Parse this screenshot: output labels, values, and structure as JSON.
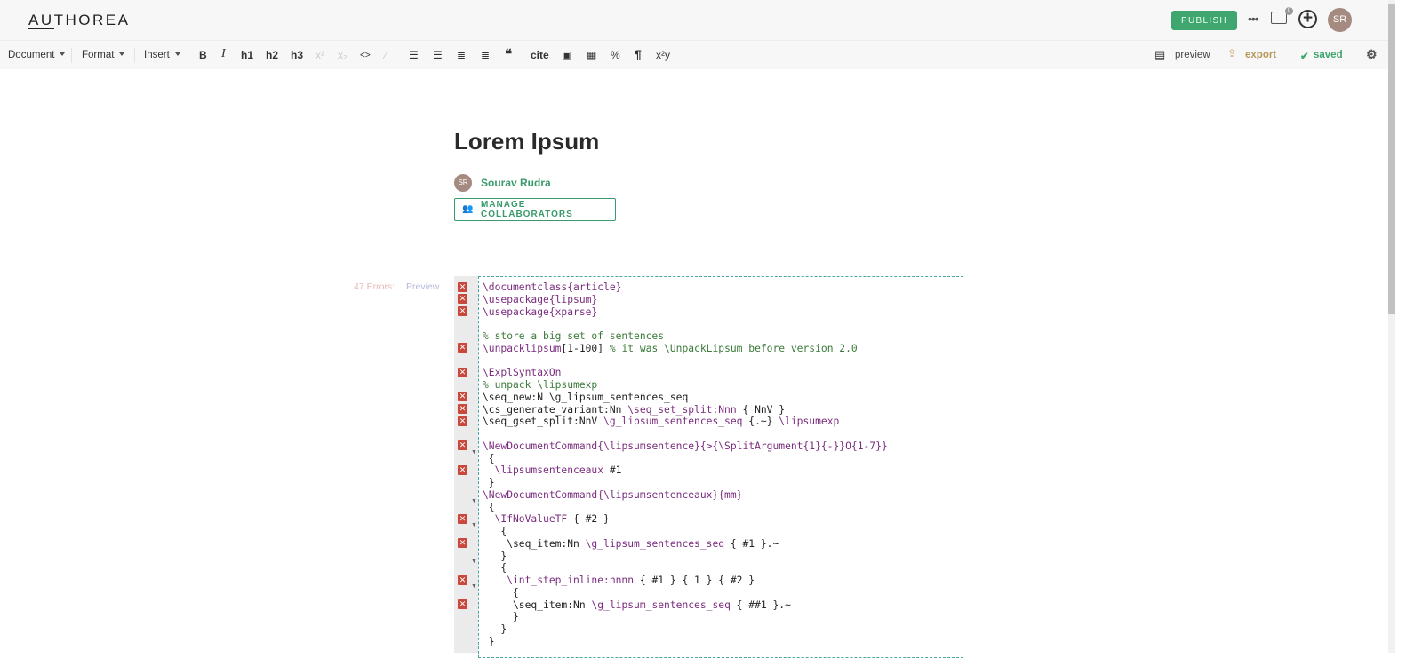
{
  "header": {
    "logo": "AUTHOREA",
    "publish": "PUBLISH",
    "more": "•••",
    "comments_badge": "0",
    "avatar": "SR"
  },
  "toolbar": {
    "document": "Document",
    "format": "Format",
    "insert": "Insert",
    "bold": "B",
    "italic": "I",
    "h1": "h1",
    "h2": "h2",
    "h3": "h3",
    "sup": "x²",
    "sub": "x₂",
    "code": "<>",
    "cite": "cite",
    "quote": "❝",
    "pilcrow": "¶",
    "xy": "x²y",
    "preview": "preview",
    "export": "export",
    "saved": "saved"
  },
  "doc": {
    "title": "Lorem Ipsum",
    "author": "Sourav Rudra",
    "author_initials": "SR",
    "collaborators": "MANAGE COLLABORATORS"
  },
  "editor": {
    "errors": "47 Errors:",
    "preview": "Preview",
    "lines": [
      {
        "e": 1,
        "t": [
          [
            "\\documentclass",
            "cmd"
          ],
          [
            "{article}",
            "arg"
          ]
        ]
      },
      {
        "e": 1,
        "t": [
          [
            "\\usepackage",
            "cmd"
          ],
          [
            "{lipsum}",
            "arg"
          ]
        ]
      },
      {
        "e": 1,
        "t": [
          [
            "\\usepackage",
            "cmd"
          ],
          [
            "{xparse}",
            "arg"
          ]
        ]
      },
      {
        "t": []
      },
      {
        "t": [
          [
            "% store a big set of sentences",
            "cmt"
          ]
        ]
      },
      {
        "e": 1,
        "t": [
          [
            "\\unpacklipsum",
            "cmd"
          ],
          [
            "[1-100] ",
            ""
          ],
          [
            "% it was \\UnpackLipsum before version 2.0",
            "cmt"
          ]
        ]
      },
      {
        "t": []
      },
      {
        "e": 1,
        "t": [
          [
            "\\ExplSyntaxOn",
            "cmd"
          ]
        ]
      },
      {
        "t": [
          [
            "% unpack \\lipsumexp",
            "cmt"
          ]
        ]
      },
      {
        "e": 1,
        "t": [
          [
            "\\seq_new:N \\g_lipsum_sentences_seq",
            ""
          ]
        ]
      },
      {
        "e": 1,
        "t": [
          [
            "\\cs_generate_variant:Nn ",
            ""
          ],
          [
            "\\seq_set_split:Nnn",
            "cmd"
          ],
          [
            " { NnV }",
            ""
          ]
        ]
      },
      {
        "e": 1,
        "t": [
          [
            "\\seq_gset_split:NnV ",
            ""
          ],
          [
            "\\g_lipsum_sentences_seq",
            "cmd"
          ],
          [
            " {.~} ",
            ""
          ],
          [
            "\\lipsumexp",
            "cmd"
          ]
        ]
      },
      {
        "t": []
      },
      {
        "e": 1,
        "t": [
          [
            "\\NewDocumentCommand",
            "cmd"
          ],
          [
            "{\\lipsumsentence}{>{\\SplitArgument{1}{-}}O{1-7}}",
            "arg"
          ]
        ]
      },
      {
        "f": 1,
        "t": [
          [
            " {",
            ""
          ]
        ]
      },
      {
        "e": 1,
        "t": [
          [
            "  \\lipsumsentenceaux",
            "cmd"
          ],
          [
            " #1",
            ""
          ]
        ]
      },
      {
        "t": [
          [
            " }",
            ""
          ]
        ]
      },
      {
        "t": [
          [
            "\\NewDocumentCommand",
            "cmd"
          ],
          [
            "{\\lipsumsentenceaux}{mm}",
            "arg"
          ]
        ]
      },
      {
        "f": 1,
        "t": [
          [
            " {",
            ""
          ]
        ]
      },
      {
        "e": 1,
        "t": [
          [
            "  \\IfNoValueTF",
            "cmd"
          ],
          [
            " { #2 }",
            ""
          ]
        ]
      },
      {
        "f": 1,
        "t": [
          [
            "   {",
            ""
          ]
        ]
      },
      {
        "e": 1,
        "t": [
          [
            "    \\seq_item:Nn ",
            ""
          ],
          [
            "\\g_lipsum_sentences_seq",
            "cmd"
          ],
          [
            " { #1 }.~",
            ""
          ]
        ]
      },
      {
        "t": [
          [
            "   }",
            ""
          ]
        ]
      },
      {
        "f": 1,
        "t": [
          [
            "   {",
            ""
          ]
        ]
      },
      {
        "e": 1,
        "t": [
          [
            "    \\int_step_inline:nnnn",
            "cmd"
          ],
          [
            " { #1 } { 1 } { #2 }",
            ""
          ]
        ]
      },
      {
        "f": 1,
        "t": [
          [
            "     {",
            ""
          ]
        ]
      },
      {
        "e": 1,
        "t": [
          [
            "     \\seq_item:Nn ",
            ""
          ],
          [
            "\\g_lipsum_sentences_seq",
            "cmd"
          ],
          [
            " { ##1 }.~",
            ""
          ]
        ]
      },
      {
        "t": [
          [
            "     }",
            ""
          ]
        ]
      },
      {
        "t": [
          [
            "   }",
            ""
          ]
        ]
      },
      {
        "t": [
          [
            " }",
            ""
          ]
        ]
      }
    ]
  }
}
